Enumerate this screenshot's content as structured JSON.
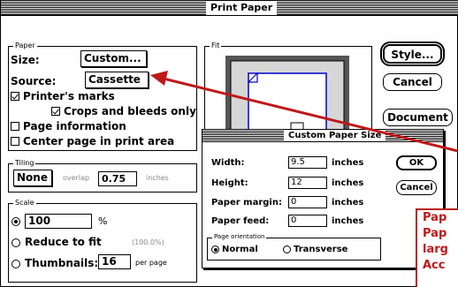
{
  "window": {
    "title": "Print Paper"
  },
  "paper": {
    "group_label": "Paper",
    "size_label": "Size:",
    "size_value": "Custom...",
    "source_label": "Source:",
    "source_value": "Cassette",
    "printers_marks": {
      "label": "Printer's marks",
      "checked": true
    },
    "crops_bleeds": {
      "label": "Crops and bleeds only",
      "checked": true
    },
    "page_information": {
      "label": "Page information",
      "checked": false
    },
    "center_page": {
      "label": "Center page in print area",
      "checked": false
    }
  },
  "fit": {
    "group_label": "Fit"
  },
  "tiling": {
    "group_label": "Tiling",
    "mode": "None",
    "overlap_label": "overlap",
    "overlap_value": "0.75",
    "overlap_unit": "inches"
  },
  "scale": {
    "group_label": "Scale",
    "percent_value": "100",
    "percent_unit": "%",
    "reduce_label": "Reduce to fit",
    "reduce_value": "(100.0%)",
    "thumbnails_label": "Thumbnails:",
    "thumbnails_value": "16",
    "thumbnails_unit": "per page",
    "selected": "percent"
  },
  "buttons": {
    "style": "Style...",
    "cancel": "Cancel",
    "document": "Document"
  },
  "custom_dialog": {
    "title": "Custom Paper Size",
    "width_label": "Width:",
    "width_value": "9.5",
    "width_unit": "inches",
    "height_label": "Height:",
    "height_value": "12",
    "height_unit": "inches",
    "margin_label": "Paper margin:",
    "margin_value": "0",
    "margin_unit": "inches",
    "feed_label": "Paper feed:",
    "feed_value": "0",
    "feed_unit": "inches",
    "orientation_label": "Page orientation",
    "normal_label": "Normal",
    "transverse_label": "Transverse",
    "orientation_selected": "normal",
    "ok": "OK",
    "cancel": "Cancel"
  },
  "annotation": {
    "lines": [
      "Pap",
      "Pap",
      "larg",
      "Acc"
    ],
    "color": "#c01818"
  }
}
